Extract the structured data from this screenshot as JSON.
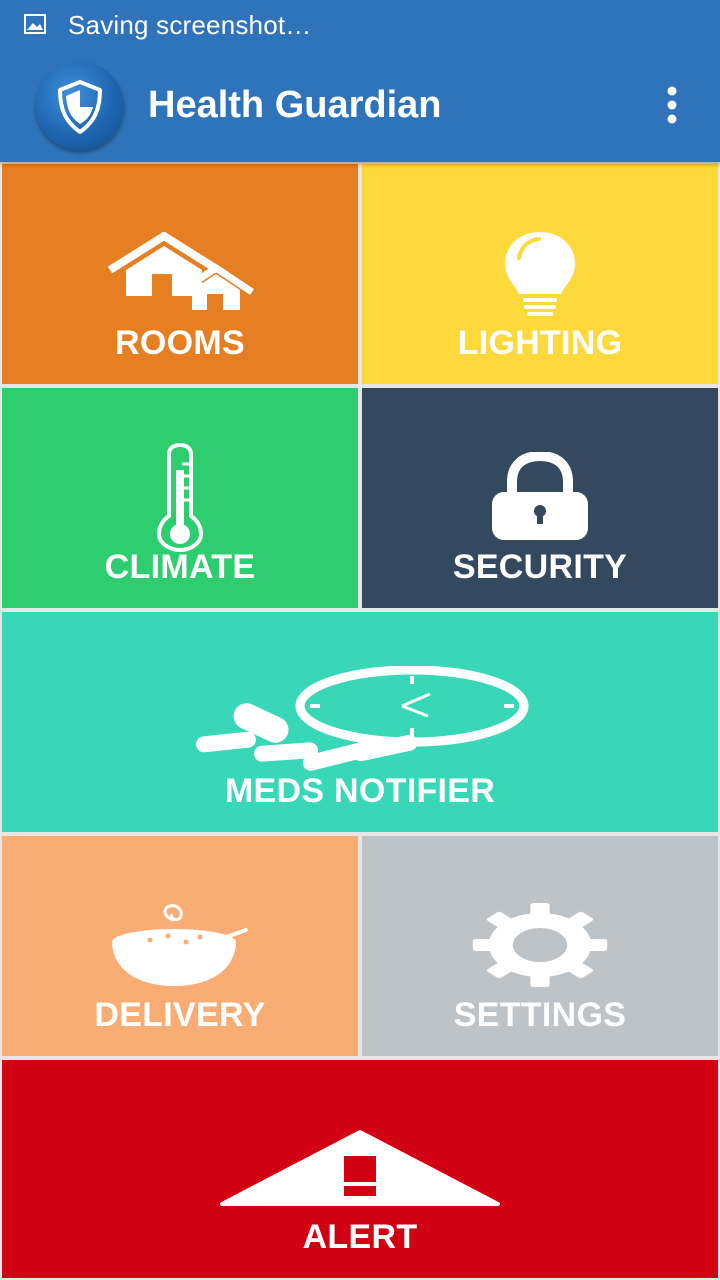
{
  "status_bar": {
    "notification_text": "Saving screenshot…"
  },
  "app_bar": {
    "title": "Health Guardian",
    "logo_icon": "shield-icon",
    "overflow_icon": "more-vertical-icon"
  },
  "tiles": [
    {
      "label": "ROOMS",
      "icon": "houses-icon",
      "color": "#e67f22"
    },
    {
      "label": "LIGHTING",
      "icon": "lightbulb-icon",
      "color": "#fed93b"
    },
    {
      "label": "CLIMATE",
      "icon": "thermometer-icon",
      "color": "#2ecd6f"
    },
    {
      "label": "SECURITY",
      "icon": "padlock-icon",
      "color": "#34495e"
    },
    {
      "label": "MEDS NOTIFIER",
      "icon": "pills-clock-icon",
      "color": "#38d7b8"
    },
    {
      "label": "DELIVERY",
      "icon": "soup-bowl-icon",
      "color": "#f9ad75"
    },
    {
      "label": "SETTINGS",
      "icon": "gear-icon",
      "color": "#bdc3c7"
    },
    {
      "label": "ALERT",
      "icon": "warning-icon",
      "color": "#d10013"
    }
  ],
  "colors": {
    "primary": "#2f74ba"
  }
}
